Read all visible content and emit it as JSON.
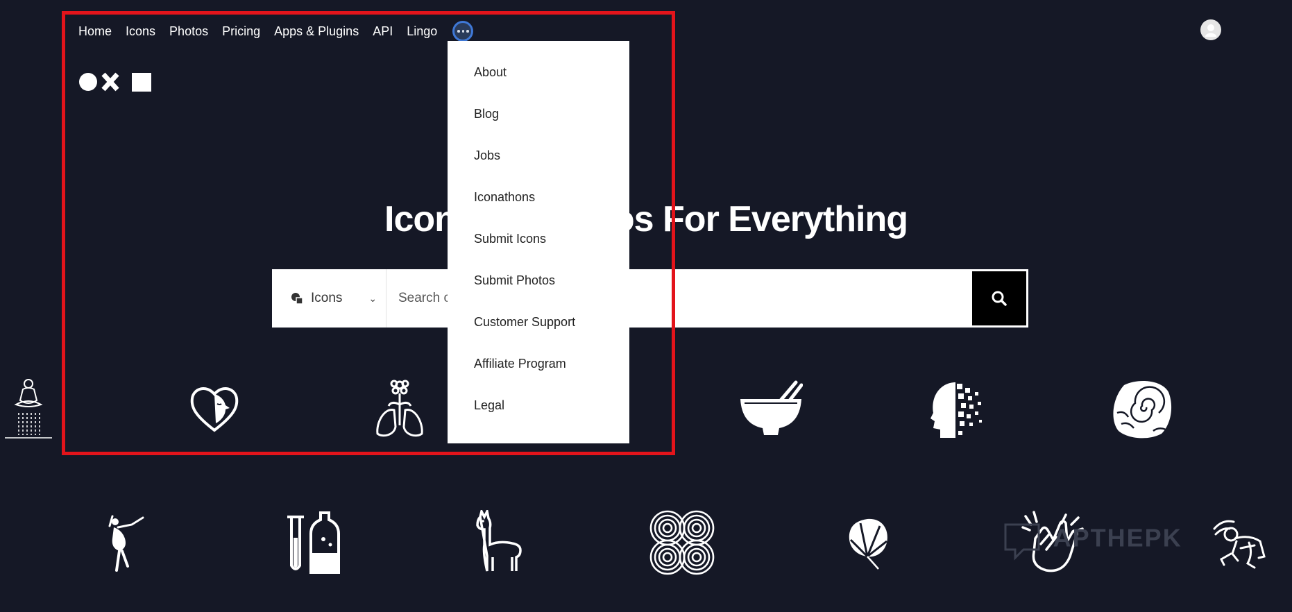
{
  "nav": {
    "items": [
      "Home",
      "Icons",
      "Photos",
      "Pricing",
      "Apps & Plugins",
      "API",
      "Lingo"
    ],
    "more_icon": "more-dots-icon"
  },
  "hero": {
    "title_visible_left": "Icon",
    "title_visible_right": "os For Everything"
  },
  "search": {
    "type_label": "Icons",
    "placeholder": "Search c"
  },
  "dropdown": {
    "items": [
      "About",
      "Blog",
      "Jobs",
      "Iconathons",
      "Submit Icons",
      "Submit Photos",
      "Customer Support",
      "Affiliate Program",
      "Legal"
    ]
  },
  "watermark": "APTHEPK",
  "icons": [
    "meditation-shower-icon",
    "heart-face-icon",
    "lungs-flower-icon",
    "noodle-bowl-icon",
    "pixel-head-icon",
    "ammonite-fossil-icon",
    "dancer-icon",
    "test-tubes-icon",
    "llama-icon",
    "spiral-knot-icon",
    "monstera-leaf-icon",
    "clapping-hands-icon",
    "dizzy-wrestler-icon"
  ],
  "colors": {
    "background": "#151826",
    "highlight": "#e3141b",
    "accent": "#3f78d6"
  }
}
